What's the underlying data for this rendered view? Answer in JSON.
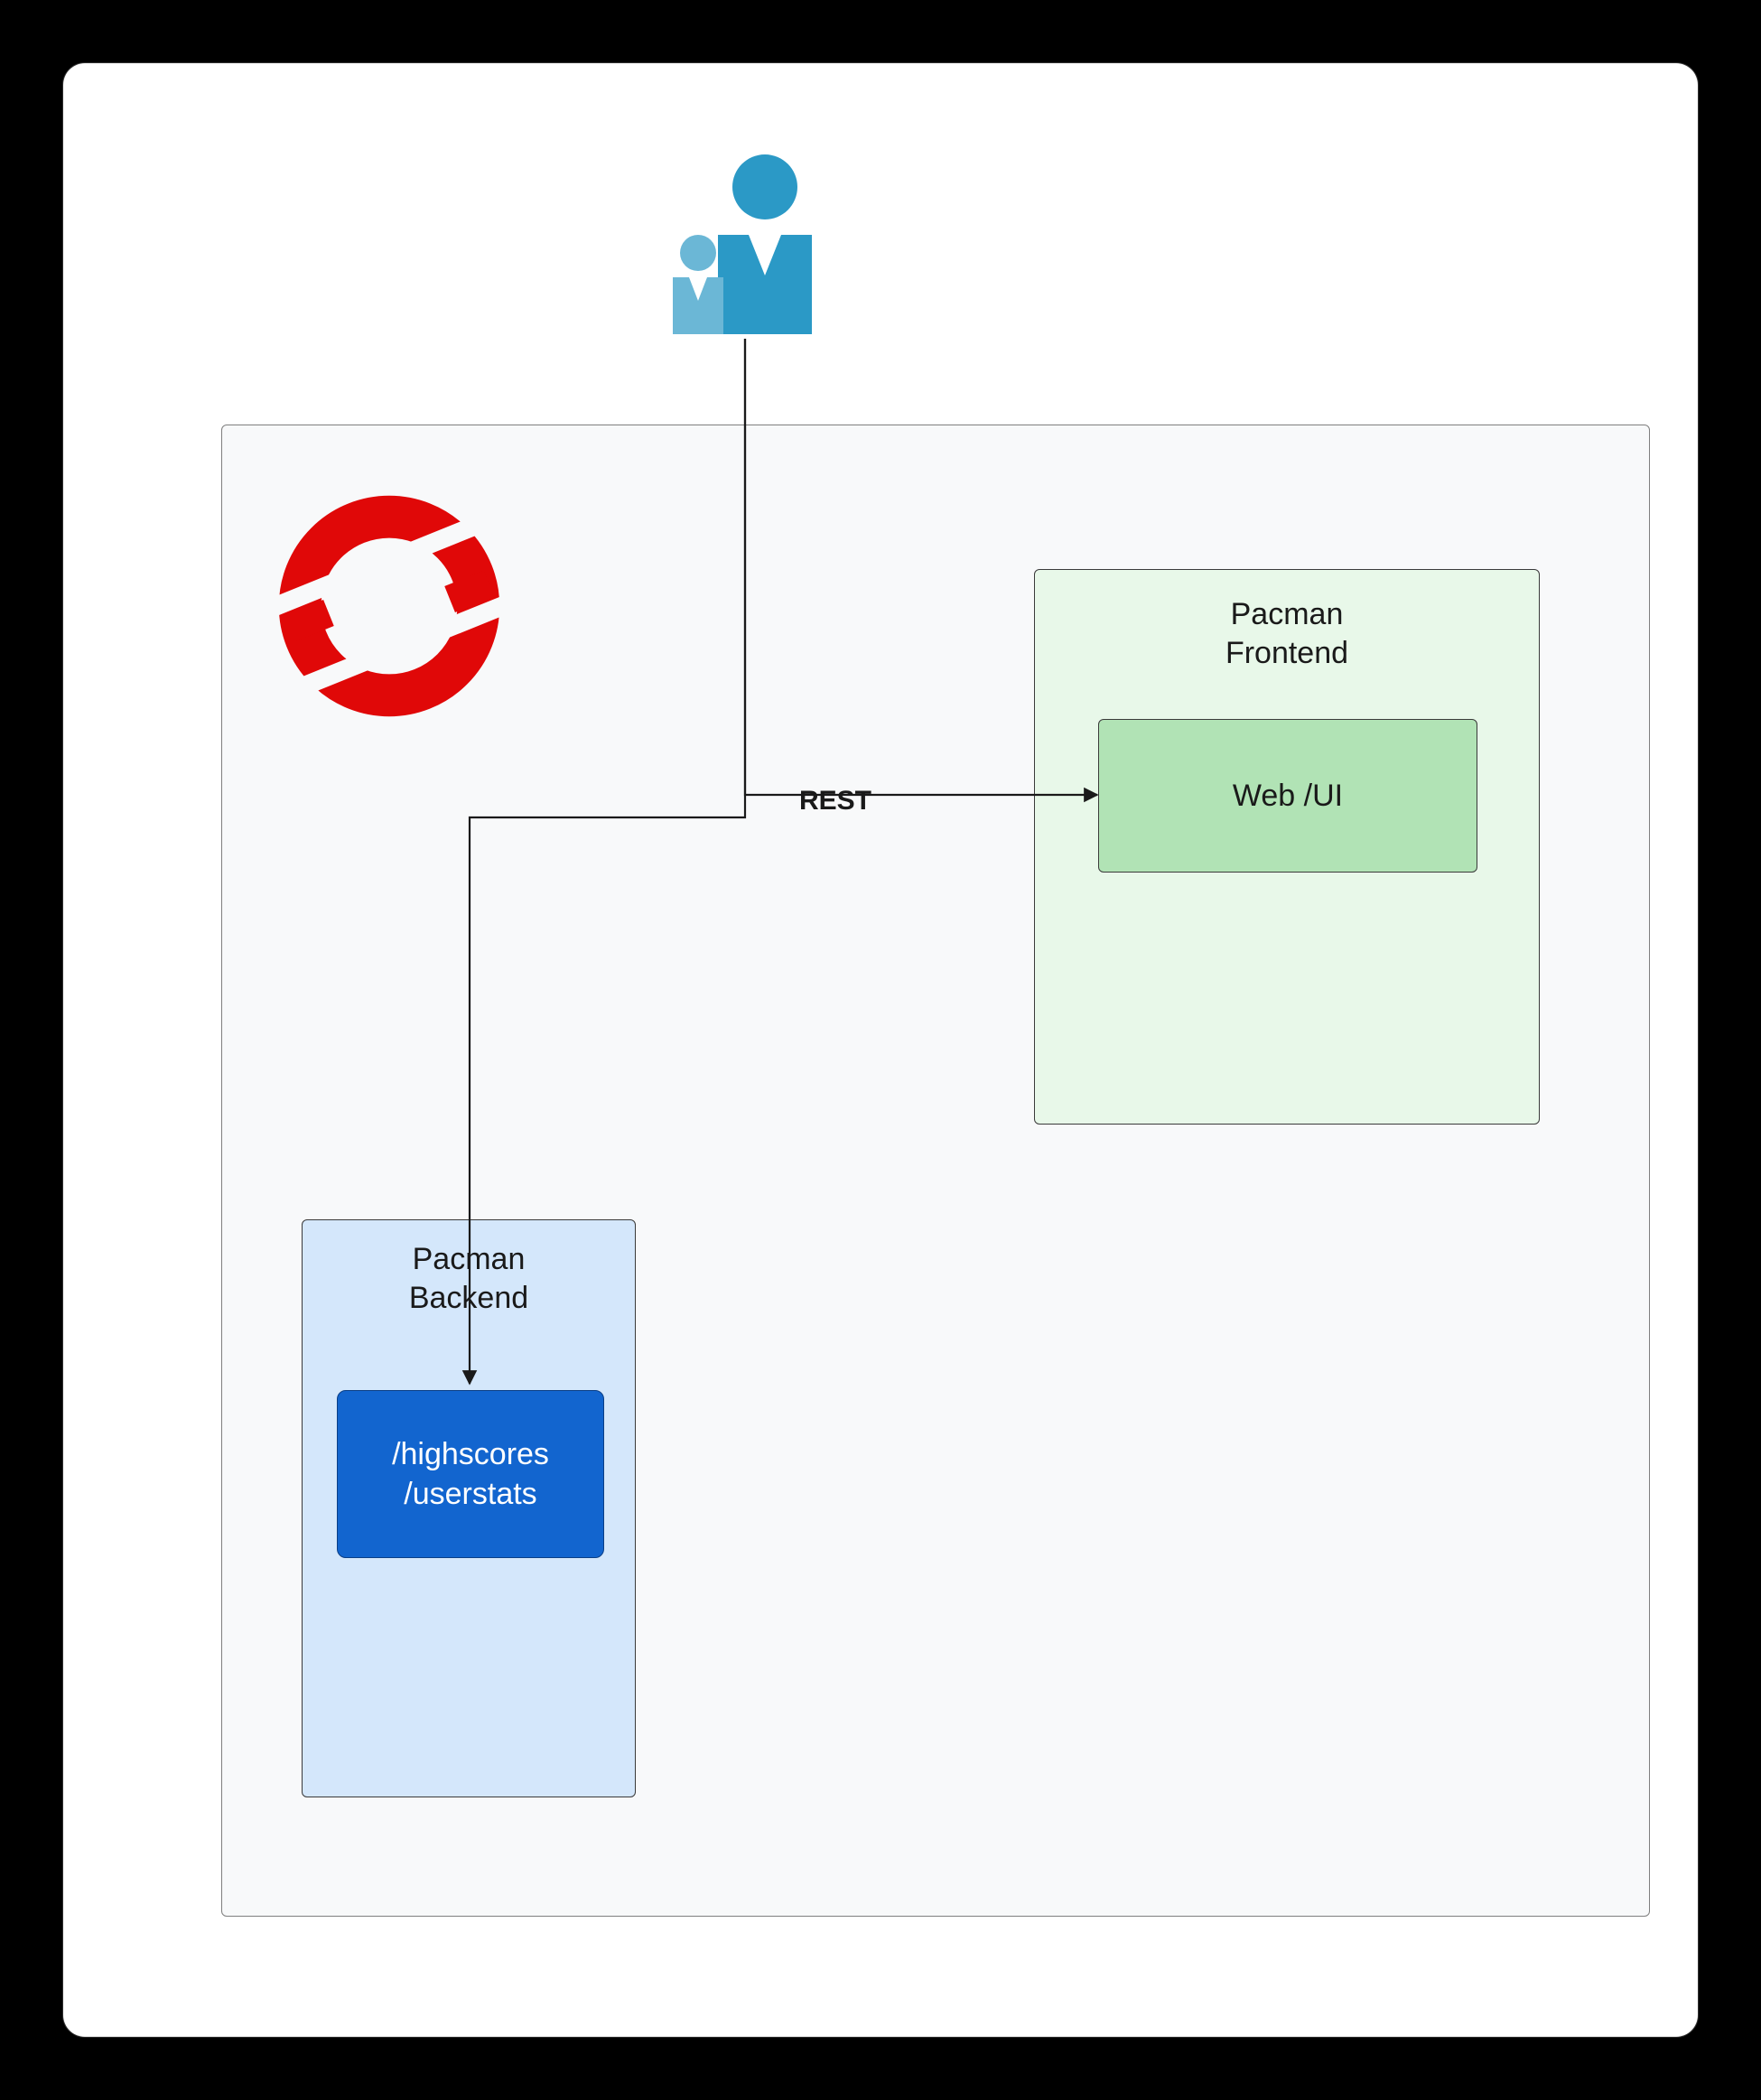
{
  "actors": {
    "users_icon": "users-icon"
  },
  "cluster": {
    "logo": "openshift-logo"
  },
  "frontend": {
    "title_line1": "Pacman",
    "title_line2": "Frontend",
    "webui_label": "Web /UI"
  },
  "backend": {
    "title_line1": "Pacman",
    "title_line2": "Backend",
    "api_line1": "/highscores",
    "api_line2": "/userstats"
  },
  "edges": {
    "rest_label": "REST"
  },
  "colors": {
    "cluster_bg": "#f8f9fa",
    "frontend_bg": "#e8f8e9",
    "webui_bg": "#b1e3b5",
    "backend_bg": "#d4e7fb",
    "api_bg": "#1265cf",
    "openshift_red": "#e00808",
    "user_blue": "#2b99c6",
    "user_blue_light": "#6bb7d6"
  }
}
